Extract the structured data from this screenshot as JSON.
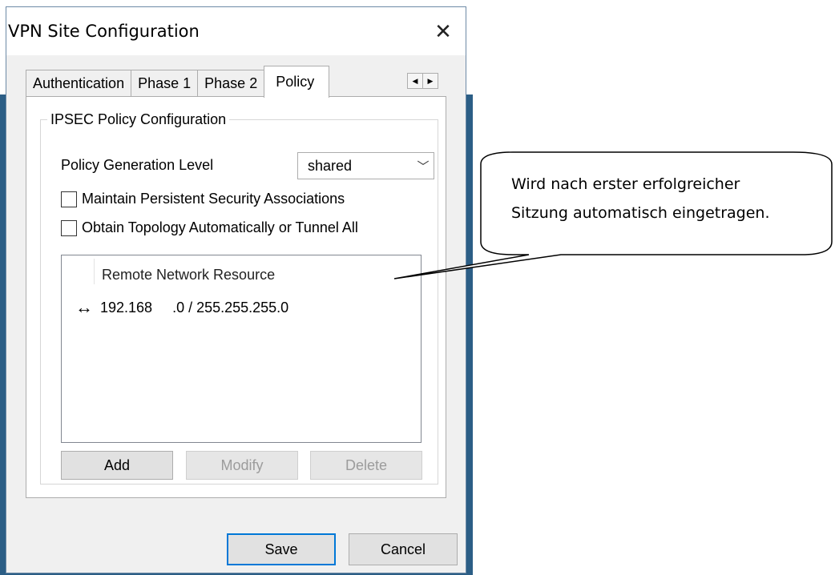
{
  "dialog": {
    "title": "VPN Site Configuration",
    "close_glyph": "✕"
  },
  "tabs": [
    {
      "label": "Authentication",
      "active": false
    },
    {
      "label": "Phase 1",
      "active": false
    },
    {
      "label": "Phase 2",
      "active": false
    },
    {
      "label": "Policy",
      "active": true
    }
  ],
  "tab_scroll": {
    "left_glyph": "◀",
    "right_glyph": "▶"
  },
  "policy_group": {
    "legend": "IPSEC Policy Configuration",
    "generation_level_label": "Policy Generation Level",
    "generation_level_value": "shared",
    "chevron_glyph": "﹀",
    "maintain_sa_label": "Maintain Persistent Security Associations",
    "maintain_sa_checked": false,
    "obtain_topology_label": "Obtain Topology Automatically or Tunnel All",
    "obtain_topology_checked": false
  },
  "resources": {
    "column_header": "Remote Network Resource",
    "items": [
      {
        "icon": "↔",
        "text": "192.168     .0 / 255.255.255.0"
      }
    ]
  },
  "buttons": {
    "add": "Add",
    "modify": "Modify",
    "delete": "Delete",
    "save": "Save",
    "cancel": "Cancel"
  },
  "callout": {
    "line1": "Wird nach erster erfolgreicher",
    "line2": "Sitzung automatisch eingetragen."
  }
}
